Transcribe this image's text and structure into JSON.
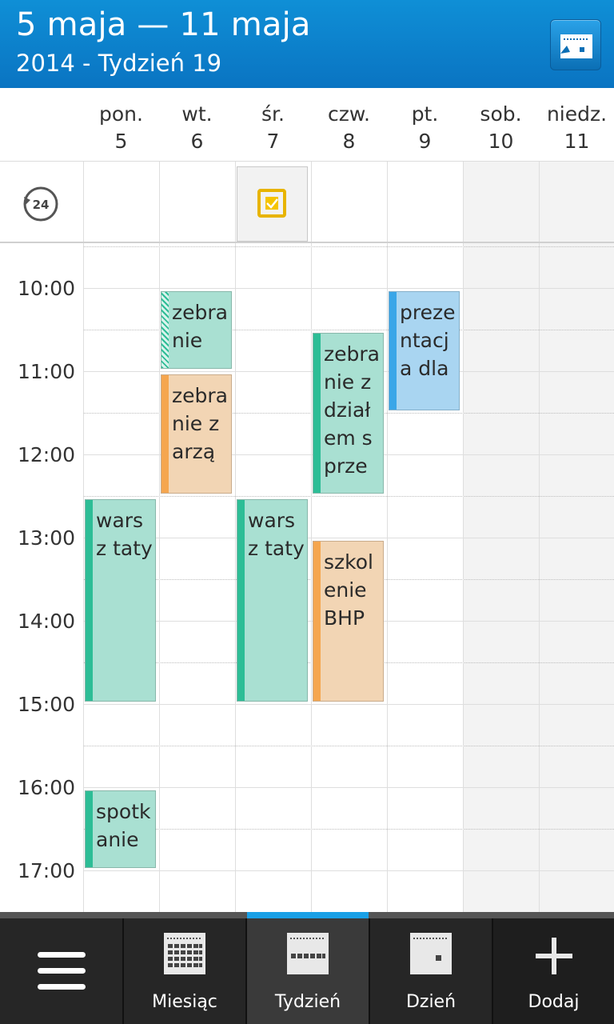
{
  "header": {
    "title": "5 maja — 11 maja",
    "subtitle": "2014 - Tydzień 19",
    "today_icon": "calendar-today-icon"
  },
  "days": [
    {
      "name": "pon.",
      "num": "5"
    },
    {
      "name": "wt.",
      "num": "6"
    },
    {
      "name": "śr.",
      "num": "7"
    },
    {
      "name": "czw.",
      "num": "8"
    },
    {
      "name": "pt.",
      "num": "9"
    },
    {
      "name": "sob.",
      "num": "10"
    },
    {
      "name": "niedz.",
      "num": "11"
    }
  ],
  "allday": {
    "icon": "24-hour-icon",
    "task_icon": "task-checkbox-icon",
    "task_day": "śr. 7"
  },
  "hours": [
    "10:00",
    "11:00",
    "12:00",
    "13:00",
    "14:00",
    "15:00",
    "16:00",
    "17:00"
  ],
  "events": [
    {
      "text": "zebra nie",
      "day": "wt. 6",
      "start": "10:00",
      "end": "11:00",
      "color": "#2dbd96"
    },
    {
      "text": "zebra nie zarzą",
      "day": "wt. 6",
      "start": "11:00",
      "end": "12:30",
      "color": "#f5a64f"
    },
    {
      "text": "zebra nie z dział em sprze",
      "day": "czw. 8",
      "start": "10:30",
      "end": "12:30",
      "color": "#2dbd96"
    },
    {
      "text": "preze ntacj a dla",
      "day": "pt. 9",
      "start": "10:00",
      "end": "11:30",
      "color": "#3aa6e8"
    },
    {
      "text": "warsz taty",
      "day": "pon. 5",
      "start": "12:30",
      "end": "15:00",
      "color": "#2dbd96"
    },
    {
      "text": "warsz taty",
      "day": "śr. 7",
      "start": "12:30",
      "end": "15:00",
      "color": "#2dbd96"
    },
    {
      "text": "szkol enie BHP",
      "day": "czw. 8",
      "start": "13:00",
      "end": "15:00",
      "color": "#f5a64f"
    },
    {
      "text": "spotk anie",
      "day": "pon. 5",
      "start": "16:00",
      "end": "17:00",
      "color": "#2dbd96"
    }
  ],
  "bottombar": {
    "menu_icon": "hamburger-menu-icon",
    "tabs": [
      {
        "label": "Miesiąc",
        "icon": "month-view-icon"
      },
      {
        "label": "Tydzień",
        "icon": "week-view-icon",
        "active": true
      },
      {
        "label": "Dzień",
        "icon": "day-view-icon"
      },
      {
        "label": "Dodaj",
        "icon": "plus-icon"
      }
    ]
  }
}
